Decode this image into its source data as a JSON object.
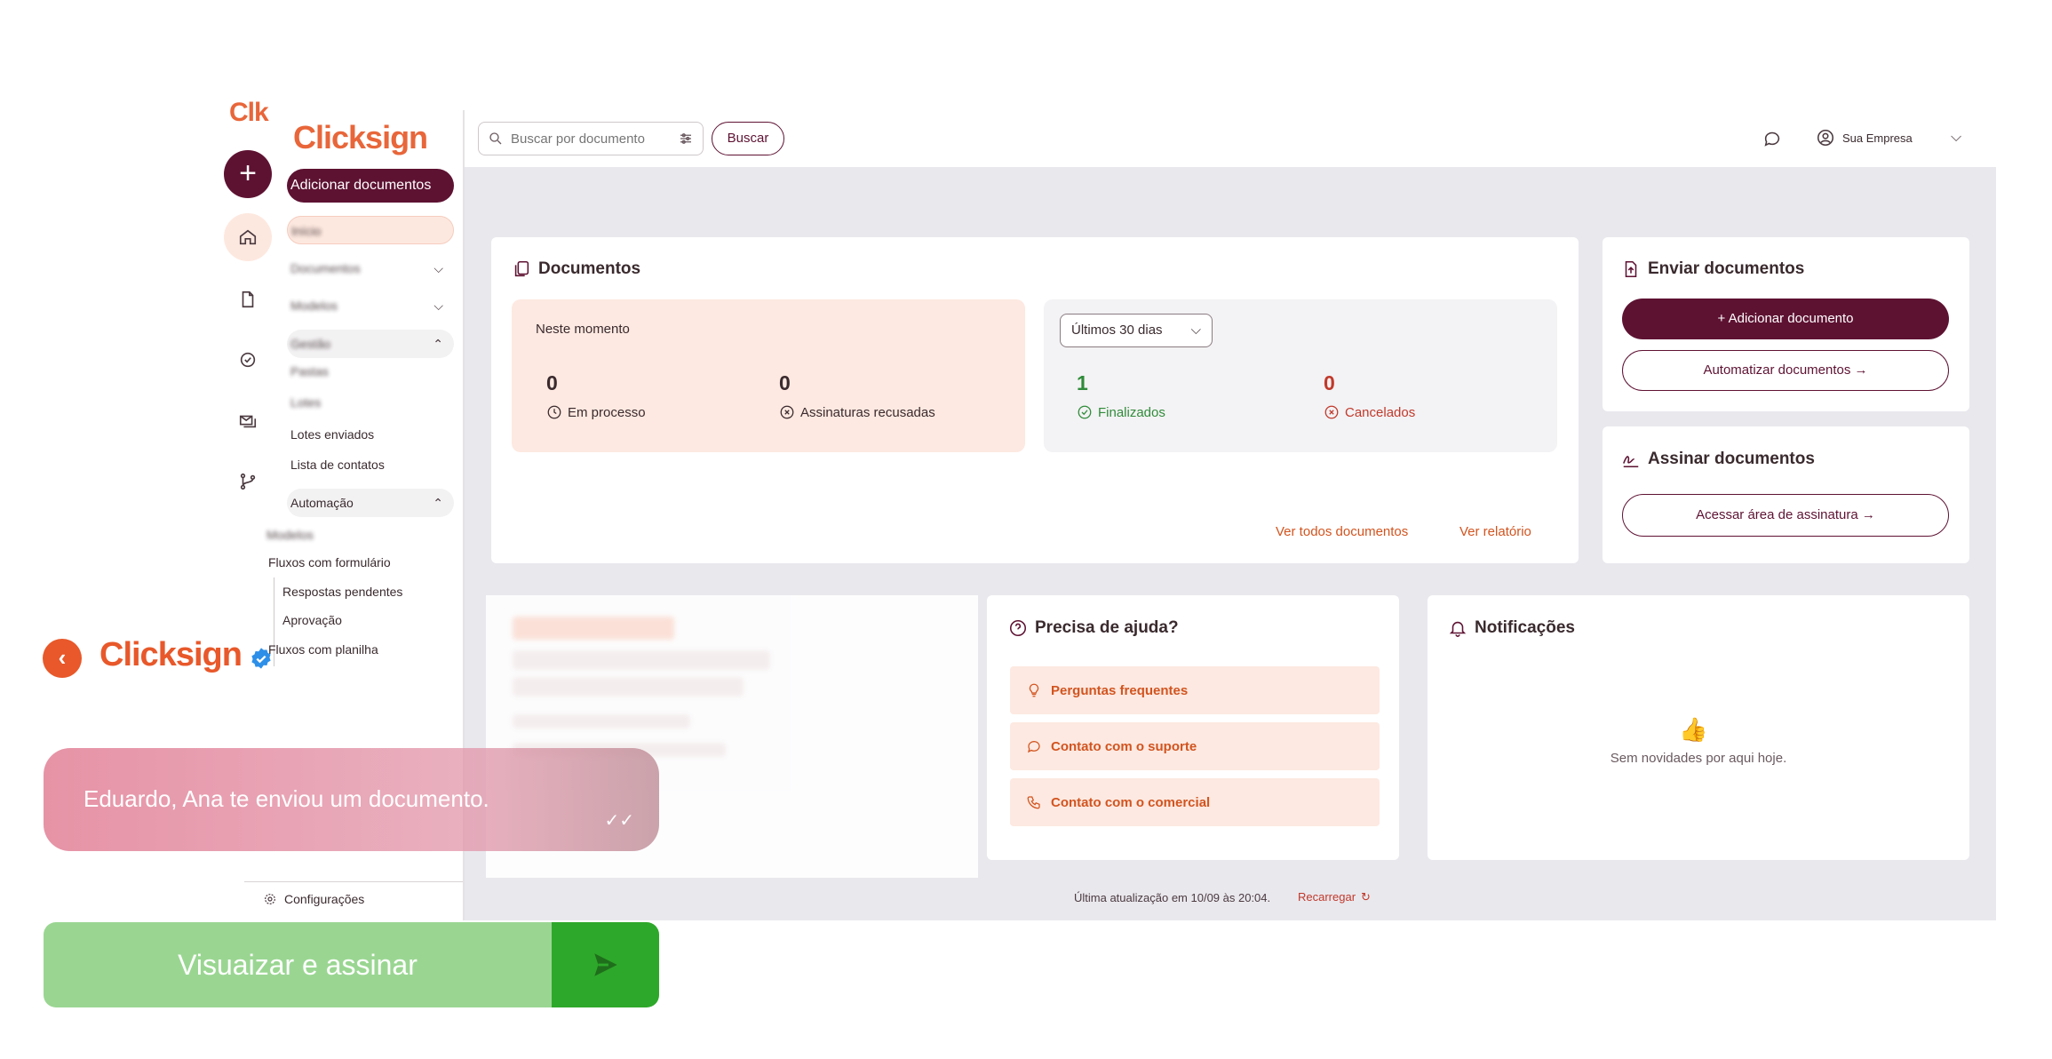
{
  "brand": {
    "rail_logo": "Clk",
    "nav_logo": "Clicksign"
  },
  "nav": {
    "add_label": "Adicionar documentos",
    "items": [
      {
        "label": "Início"
      },
      {
        "label": "Documentos"
      },
      {
        "label": "Modelos"
      },
      {
        "label": "Gestão"
      },
      {
        "label": "Pastas"
      },
      {
        "label": "Lotes"
      },
      {
        "label": "Lotes enviados"
      },
      {
        "label": "Lista de contatos"
      },
      {
        "label": "Automação"
      },
      {
        "label": "Modelos"
      },
      {
        "label": "Fluxos com formulário"
      },
      {
        "label": "Respostas pendentes"
      },
      {
        "label": "Aprovação"
      },
      {
        "label": "Fluxos com planilha"
      }
    ],
    "settings": "Configurações"
  },
  "topbar": {
    "search_placeholder": "Buscar por documento",
    "search_button": "Buscar",
    "company": "Sua Empresa"
  },
  "documents": {
    "title": "Documentos",
    "now_label": "Neste momento",
    "in_process_value": "0",
    "in_process_label": "Em processo",
    "refused_value": "0",
    "refused_label": "Assinaturas recusadas",
    "period": "Últimos 30 dias",
    "finished_value": "1",
    "finished_label": "Finalizados",
    "cancelled_value": "0",
    "cancelled_label": "Cancelados",
    "see_all": "Ver todos documentos",
    "see_report": "Ver relatório"
  },
  "send": {
    "title": "Enviar documentos",
    "add": "Adicionar documento",
    "automate": "Automatizar documentos"
  },
  "sign": {
    "title": "Assinar documentos",
    "access": "Acessar área de assinatura"
  },
  "help": {
    "title": "Precisa de ajuda?",
    "items": [
      "Perguntas frequentes",
      "Contato com o suporte",
      "Contato com o comercial"
    ]
  },
  "notifications": {
    "title": "Notificações",
    "empty": "Sem novidades por aqui hoje."
  },
  "footer": {
    "updated": "Última atualização em 10/09 às 20:04.",
    "reload": "Recarregar"
  },
  "promo": {
    "brand": "Clicksign",
    "message": "Eduardo, Ana te enviou um documento.",
    "cta": "Visuaizar e assinar"
  },
  "colors": {
    "brand_wine": "#5e1232",
    "brand_orange": "#e8663a",
    "cta_green": "#2ea82a"
  }
}
